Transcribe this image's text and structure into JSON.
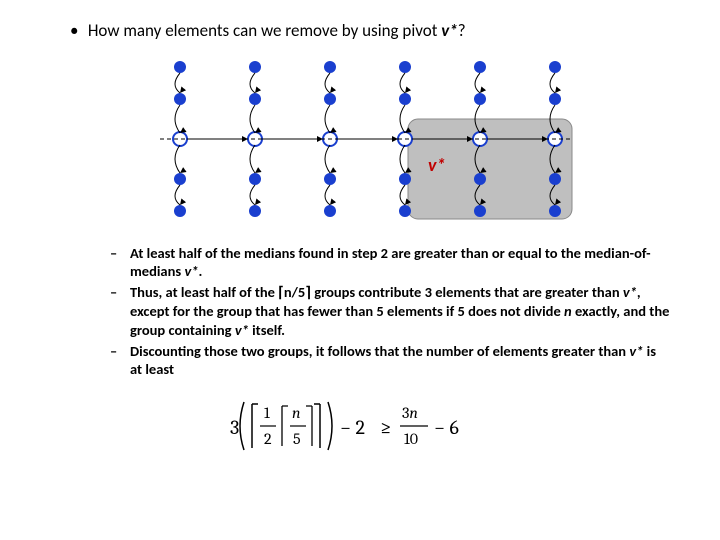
{
  "main_bullet": {
    "marker": "•",
    "text_a": "How many elements can we remove by using pivot ",
    "vstar": "v*",
    "text_b": "?"
  },
  "diagram": {
    "vstar_label": "v*",
    "cols": 6,
    "rows_per_col": 5
  },
  "subs": [
    {
      "dash": "–",
      "parts": [
        {
          "t": "At least half of the medians found in step 2 are greater than or equal to the median-of-medians "
        },
        {
          "t": "v*",
          "ital": true
        },
        {
          "t": "."
        }
      ]
    },
    {
      "dash": "–",
      "parts": [
        {
          "t": "Thus, at least half of the "
        },
        {
          "t": "⌈",
          "ceil": true
        },
        {
          "t": "n/5"
        },
        {
          "t": "⌉",
          "ceil": true
        },
        {
          "t": " groups contribute 3 elements that are greater than "
        },
        {
          "t": "v*",
          "ital": true
        },
        {
          "t": ", except for the group that has fewer than 5 elements if 5 does not divide "
        },
        {
          "t": "n",
          "ital": true
        },
        {
          "t": " exactly,  and the group containing "
        },
        {
          "t": "v*",
          "ital": true
        },
        {
          "t": " itself."
        }
      ]
    },
    {
      "dash": "–",
      "parts": [
        {
          "t": "Discounting those two groups, it follows that the number of elements greater than "
        },
        {
          "t": "v*",
          "ital": true
        },
        {
          "t": " is at least"
        }
      ]
    }
  ],
  "formula": {
    "three": "3",
    "half_num": "1",
    "half_den": "2",
    "n5_num": "n",
    "n5_den": "5",
    "minus2": "− 2",
    "geq": "≥",
    "rhs_num": "3n",
    "rhs_den": "10",
    "minus6": "− 6"
  }
}
